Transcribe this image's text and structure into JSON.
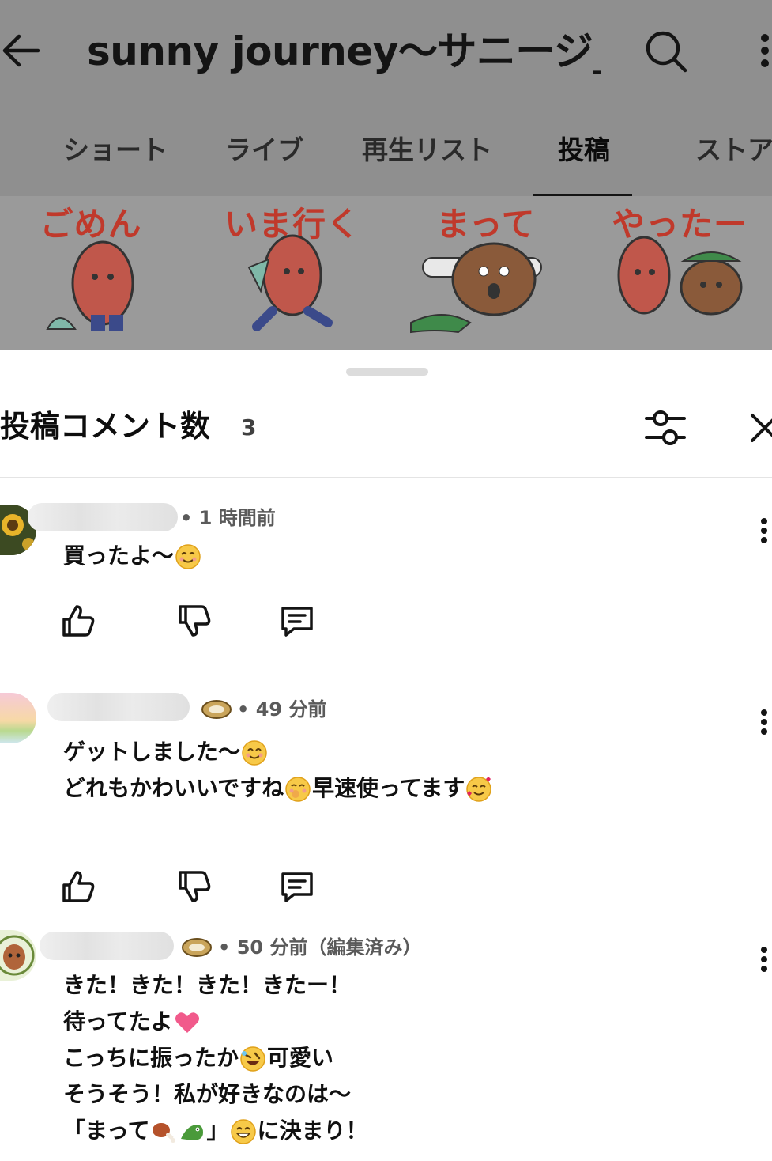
{
  "header": {
    "channel_title": "sunny journey～サニージ_",
    "tabs": [
      {
        "label": "ショート"
      },
      {
        "label": "ライブ"
      },
      {
        "label": "再生リスト"
      },
      {
        "label": "投稿",
        "active": true
      },
      {
        "label": "ストア"
      }
    ]
  },
  "stickers": [
    {
      "caption": "ごめん"
    },
    {
      "caption": "いま行く"
    },
    {
      "caption": "まって"
    },
    {
      "caption": "やったー"
    }
  ],
  "sheet": {
    "title": "投稿コメント数",
    "count": "3"
  },
  "comments": [
    {
      "time": "• 1 時間前",
      "lines": [
        "買ったよ～"
      ],
      "line_emoji": [
        [
          "smile"
        ]
      ],
      "avatar": "sunflower"
    },
    {
      "time": "• 49 分前",
      "lines": [
        "ゲットしました～",
        "どれもかわいいですね",
        "早速使ってます"
      ],
      "line_emoji": [
        [
          "smile"
        ],
        [
          "shy"
        ],
        [
          "love"
        ]
      ],
      "avatar": "sunset"
    },
    {
      "time": "• 50 分前（編集済み）",
      "lines": [
        "きた！きた！きた！きたー！",
        "待ってたよ",
        "こっちに振ったか",
        "可愛い",
        "そうそう！私が好きなのは～",
        "「まって",
        "」",
        "に決まり！"
      ],
      "avatar": "character"
    }
  ],
  "colors": {
    "dim_bg": "#8f8f8f",
    "sheet_bg": "#ffffff",
    "meta_text": "#5a5a5a",
    "accent_red": "#c0392b"
  }
}
